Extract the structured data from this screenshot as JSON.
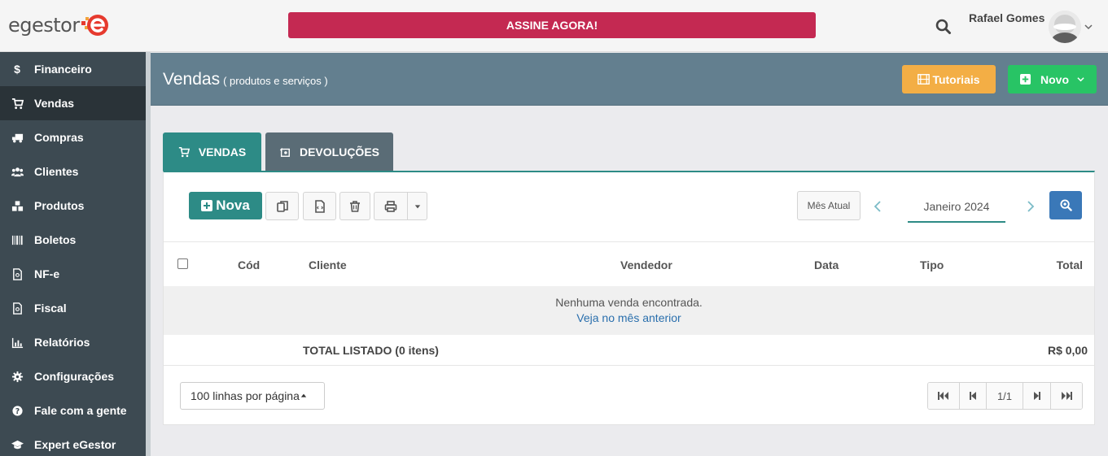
{
  "topbar": {
    "logo_text": "egestor",
    "cta_label": "ASSINE AGORA!",
    "user_name": "Rafael Gomes",
    "colors": {
      "cta": "#c42952",
      "logo_accent": "#e63a2e"
    }
  },
  "sidebar": {
    "items": [
      {
        "label": "Financeiro",
        "icon": "dollar-icon"
      },
      {
        "label": "Vendas",
        "icon": "cart-icon",
        "active": true
      },
      {
        "label": "Compras",
        "icon": "truck-icon"
      },
      {
        "label": "Clientes",
        "icon": "users-icon"
      },
      {
        "label": "Produtos",
        "icon": "cubes-icon"
      },
      {
        "label": "Boletos",
        "icon": "barcode-icon"
      },
      {
        "label": "NF-e",
        "icon": "document-icon"
      },
      {
        "label": "Fiscal",
        "icon": "document-icon"
      },
      {
        "label": "Relatórios",
        "icon": "bar-chart-icon"
      },
      {
        "label": "Configurações",
        "icon": "gear-icon"
      },
      {
        "label": "Fale com a gente",
        "icon": "question-icon"
      },
      {
        "label": "Expert eGestor",
        "icon": "graduation-cap-icon"
      }
    ]
  },
  "header": {
    "title": "Vendas",
    "subtitle": "( produtos e serviços )",
    "tutorials_label": "Tutoriais",
    "new_label": "Novo",
    "colors": {
      "bar": "#637f8f",
      "tutorials": "#f3ae45",
      "new": "#28c465"
    }
  },
  "tabs": [
    {
      "label": "VENDAS",
      "icon": "cart-icon",
      "active": true
    },
    {
      "label": "DEVOLUÇÕES",
      "icon": "return-icon"
    }
  ],
  "toolbar": {
    "new_label": "Nova",
    "current_month_label": "Mês Atual",
    "month": "Janeiro 2024"
  },
  "table": {
    "columns": [
      "Cód",
      "Cliente",
      "Vendedor",
      "Data",
      "Tipo",
      "Total"
    ],
    "empty_message": "Nenhuma venda encontrada.",
    "empty_link": "Veja no mês anterior",
    "total_label": "TOTAL LISTADO (0 itens)",
    "total_value": "R$ 0,00"
  },
  "footer": {
    "per_page": "100 linhas por página",
    "page_indicator": "1/1"
  }
}
